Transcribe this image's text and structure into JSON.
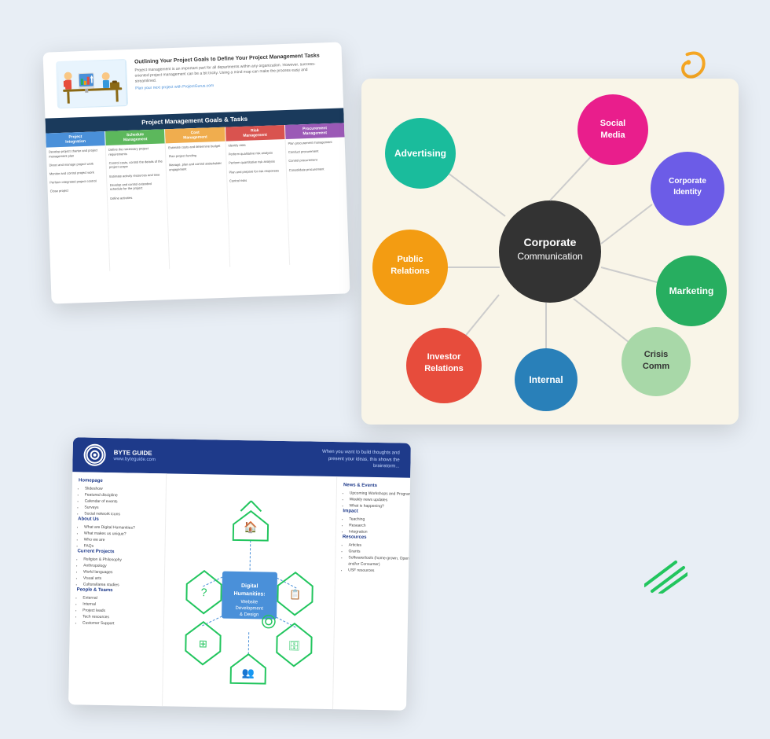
{
  "background_color": "#e8eef5",
  "decorations": {
    "swirl_yellow": "〜",
    "swirl_blue": "〜",
    "green_lines": "///",
    "colors": {
      "yellow": "#f5a623",
      "blue": "#2563eb",
      "green": "#22c55e"
    }
  },
  "card_pm": {
    "title": "Outlining Your Project Goals to Define Your Project Management Tasks",
    "description": "Project management is an important part for all departments within any organization. However, success-oriented project management can be a bit tricky. Using a mind map can make the process easy and streamlined.",
    "tagline": "Plan your next project with ProjectGurus.com",
    "table_title": "Project Management Goals & Tasks",
    "columns": [
      {
        "label": "Project Integration",
        "color": "#4a90d9"
      },
      {
        "label": "Schedule Management",
        "color": "#5cb85c"
      },
      {
        "label": "Cost Management",
        "color": "#f0ad4e"
      },
      {
        "label": "Risk Management",
        "color": "#d9534f"
      },
      {
        "label": "Procurement Management",
        "color": "#9b59b6"
      }
    ],
    "rows": [
      [
        "Develop project charter and project management plan",
        "Define the necessary project requirements",
        "Estimate costs and determine budget",
        "Identify risks",
        "Plan procurement management"
      ],
      [
        "Direct and manage project work",
        "Control costs, control the details of the project scope",
        "Plan project funding",
        "Perform qualitative risk analysis",
        "Conduct procurement"
      ],
      [
        "Monitor and control project work",
        "Estimate activity resources and time",
        "Manage, plan and control stakeholder engagement",
        "Perform quantitative risk analysis",
        "Control procurement"
      ],
      [
        "Perform integrated project control",
        "Develop and control extended schedule for the project",
        "",
        "Plan and prepare for risk responses",
        "Consolidate procurement"
      ],
      [
        "Close project",
        "Define activities",
        "",
        "Control risks",
        ""
      ]
    ]
  },
  "card_mindmap": {
    "center": {
      "label": "Corporate Communication",
      "color": "#333333"
    },
    "nodes": [
      {
        "label": "Social Media",
        "color": "#e91e8c",
        "angle": 315,
        "distance": 150
      },
      {
        "label": "Corporate Identity",
        "color": "#6c5ce7",
        "angle": 0,
        "distance": 160
      },
      {
        "label": "Marketing",
        "color": "#27ae60",
        "angle": 45,
        "distance": 155
      },
      {
        "label": "Crisis Comm",
        "color": "#a8d8a8",
        "angle": 90,
        "distance": 155
      },
      {
        "label": "Internal",
        "color": "#2980b9",
        "angle": 120,
        "distance": 150
      },
      {
        "label": "Investor Relations",
        "color": "#e74c3c",
        "angle": 180,
        "distance": 155
      },
      {
        "label": "Public Relations",
        "color": "#f39c12",
        "angle": 225,
        "distance": 160
      },
      {
        "label": "Advertising",
        "color": "#1abc9c",
        "angle": 270,
        "distance": 155
      }
    ]
  },
  "card_byteguide": {
    "brand": "BYTE GUIDE",
    "url": "www.byteguide.com",
    "tagline": "When you want to build thoughts and present your ideas, this shows the brainstorm...",
    "title": "Digital Humanities: Website Development & Design",
    "sections_left": [
      {
        "title": "Homepage",
        "items": [
          "Slideshow",
          "Featured discipline",
          "Calendar of events",
          "Surveys",
          "Social network icons"
        ]
      },
      {
        "title": "About Us",
        "items": [
          "What are Digital Humanities?",
          "What makes us unique?",
          "Who we are",
          "FAQs"
        ]
      },
      {
        "title": "Current Projects",
        "items": [
          "Religion & Philosophy",
          "Anthropology",
          "World languages",
          "Visual arts",
          "Cultural/area studies"
        ]
      },
      {
        "title": "People & Teams",
        "items": [
          "External",
          "Internal",
          "Project leads",
          "Tech resources",
          "Customer Support"
        ]
      }
    ],
    "sections_right": [
      {
        "title": "News & Events",
        "items": [
          "Upcoming Workshops and Programs",
          "Weekly news updates",
          "What is happening?"
        ]
      },
      {
        "title": "Impact",
        "items": [
          "Teaching",
          "Research",
          "Integration"
        ]
      },
      {
        "title": "Resources",
        "items": [
          "Articles",
          "Grants",
          "Software/tools (home-grown, Open-source and/or Consumer)",
          "USF resources"
        ]
      }
    ]
  }
}
